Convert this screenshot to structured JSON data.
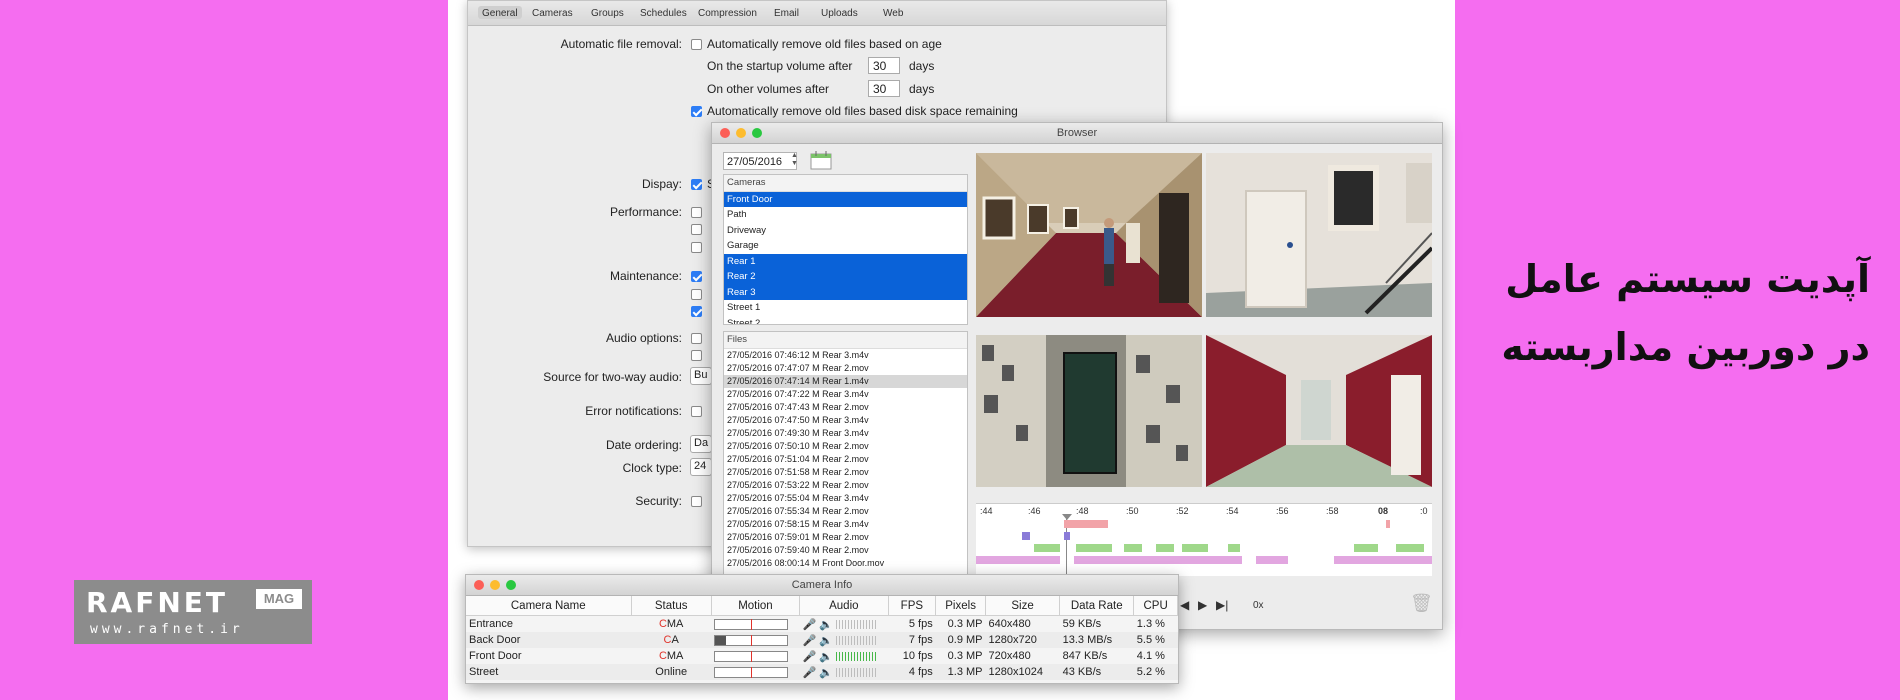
{
  "headline": {
    "line1": "آپدیت سیستم عامل",
    "line2": "در دوربین مداربسته"
  },
  "logo": {
    "word": "RAFNET",
    "badge": "MAG",
    "url": "www.rafnet.ir"
  },
  "prefs": {
    "toolbar": [
      "General",
      "Cameras",
      "Groups",
      "Schedules",
      "Compression",
      "Email",
      "Uploads",
      "Web"
    ],
    "auto_removal_label": "Automatic file removal:",
    "remove_age": "Automatically remove old files based on age",
    "startup_label": "On the startup volume after",
    "startup_value": "30",
    "startup_unit": "days",
    "other_label": "On other volumes after",
    "other_value": "30",
    "other_unit": "days",
    "remove_space": "Automatically remove old files based disk space remaining",
    "labels": {
      "display": "Dispay:",
      "performance": "Performance:",
      "maintenance": "Maintenance:",
      "audio": "Audio options:",
      "two_way": "Source for two-way audio:",
      "errors": "Error notifications:",
      "date_ordering": "Date ordering:",
      "clock": "Clock type:",
      "security": "Security:"
    },
    "clipped": {
      "display": "S",
      "two_way": "Bu",
      "date": "Da",
      "clock": "24"
    }
  },
  "browser": {
    "title": "Browser",
    "date": "27/05/2016",
    "cameras_header": "Cameras",
    "cameras": [
      "Front Door",
      "Path",
      "Driveway",
      "Garage",
      "Rear 1",
      "Rear 2",
      "Rear 3",
      "Street 1",
      "Street 2"
    ],
    "files_header": "Files",
    "files": [
      "27/05/2016 07:46:12 M Rear 3.m4v",
      "27/05/2016 07:47:07 M Rear 2.mov",
      "27/05/2016 07:47:14 M Rear 1.m4v",
      "27/05/2016 07:47:22 M Rear 3.m4v",
      "27/05/2016 07:47:43 M Rear 2.mov",
      "27/05/2016 07:47:50 M Rear 3.m4v",
      "27/05/2016 07:49:30 M Rear 3.m4v",
      "27/05/2016 07:50:10 M Rear 2.mov",
      "27/05/2016 07:51:04 M Rear 2.mov",
      "27/05/2016 07:51:58 M Rear 2.mov",
      "27/05/2016 07:53:22 M Rear 2.mov",
      "27/05/2016 07:55:04 M Rear 3.m4v",
      "27/05/2016 07:55:34 M Rear 2.mov",
      "27/05/2016 07:58:15 M Rear 3.m4v",
      "27/05/2016 07:59:01 M Rear 2.mov",
      "27/05/2016 07:59:40 M Rear 2.mov",
      "27/05/2016 08:00:14 M Front Door.mov"
    ],
    "timeline_ticks": [
      ":44",
      ":46",
      ":48",
      ":50",
      ":52",
      ":54",
      ":56",
      ":58",
      "08",
      ":0"
    ],
    "speed": "0x"
  },
  "caminfo": {
    "title": "Camera Info",
    "columns": [
      "Camera Name",
      "Status",
      "Motion",
      "Audio",
      "FPS",
      "Pixels",
      "Size",
      "Data Rate",
      "CPU"
    ],
    "rows": [
      {
        "name": "Entrance",
        "status_c": "C",
        "status_rest": "MA",
        "motion": 0.0,
        "audio_live": false,
        "fps": "5 fps",
        "pixels": "0.3 MP",
        "size": "640x480",
        "rate": "59 KB/s",
        "cpu": "1.3 %"
      },
      {
        "name": "Back Door",
        "status_c": "C",
        "status_rest": "A",
        "motion": 0.15,
        "audio_live": false,
        "fps": "7 fps",
        "pixels": "0.9 MP",
        "size": "1280x720",
        "rate": "13.3 MB/s",
        "cpu": "5.5 %"
      },
      {
        "name": "Front Door",
        "status_c": "C",
        "status_rest": "MA",
        "motion": 0.0,
        "audio_live": true,
        "fps": "10 fps",
        "pixels": "0.3 MP",
        "size": "720x480",
        "rate": "847 KB/s",
        "cpu": "4.1 %"
      },
      {
        "name": "Street",
        "status_c": "",
        "status_rest": "Online",
        "motion": 0.0,
        "audio_live": false,
        "fps": "4 fps",
        "pixels": "1.3 MP",
        "size": "1280x1024",
        "rate": "43 KB/s",
        "cpu": "5.2 %"
      }
    ]
  },
  "colors": {
    "background": "#f56df0",
    "selection": "#0a62d8",
    "motion_red": "#e0332b"
  }
}
